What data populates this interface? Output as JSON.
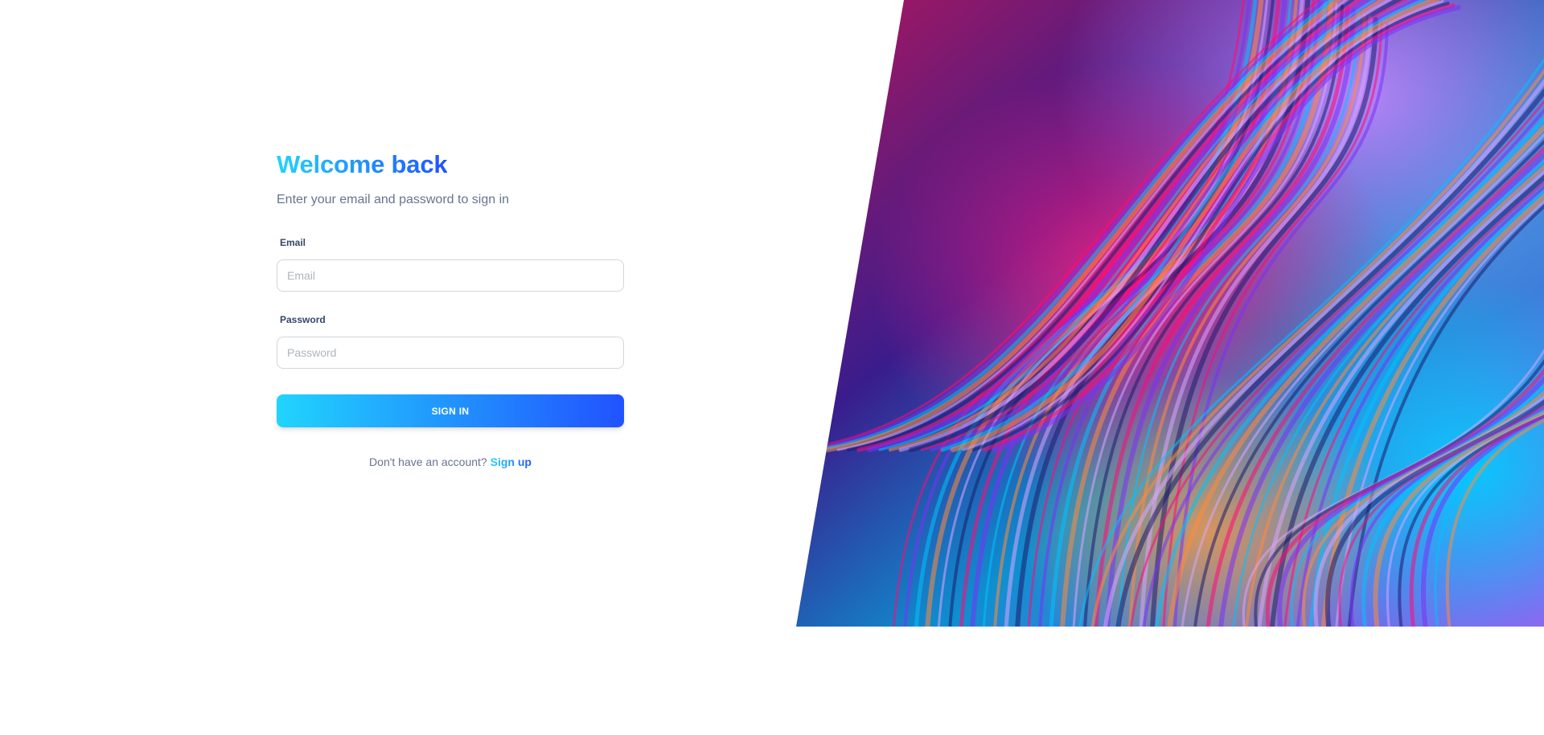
{
  "signin": {
    "title": "Welcome back",
    "subtitle": "Enter your email and password to sign in",
    "email_label": "Email",
    "email_placeholder": "Email",
    "email_value": "",
    "password_label": "Password",
    "password_placeholder": "Password",
    "password_value": "",
    "submit_label": "SIGN IN",
    "signup_prompt": "Don't have an account?",
    "signup_link": "Sign up"
  },
  "theme": {
    "gradient_start": "#21d4fd",
    "gradient_end": "#2152ff",
    "text_muted": "#67748e",
    "label_color": "#344767",
    "border_color": "#d2d6da"
  },
  "artwork": {
    "description_icon": "abstract-swirl-image",
    "palette": [
      "#ff0a78",
      "#7b2ff7",
      "#00c2ff",
      "#ff8a3d",
      "#d9a6ff",
      "#1d1b6b"
    ]
  }
}
